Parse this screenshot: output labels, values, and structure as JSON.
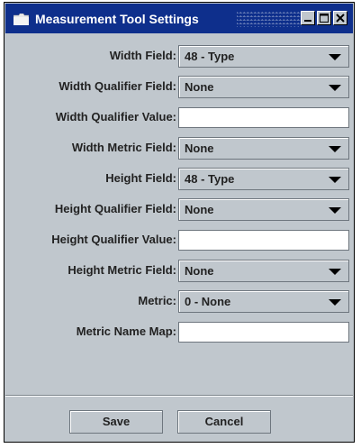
{
  "window": {
    "title": "Measurement Tool Settings",
    "controls": {
      "minimize_icon": "minimize-icon",
      "maximize_icon": "maximize-icon",
      "close_icon": "close-icon"
    }
  },
  "form": {
    "fields": [
      {
        "label": "Width Field:",
        "type": "select",
        "value": "48 - Type"
      },
      {
        "label": "Width Qualifier Field:",
        "type": "select",
        "value": "None"
      },
      {
        "label": "Width Qualifier Value:",
        "type": "text",
        "value": ""
      },
      {
        "label": "Width Metric Field:",
        "type": "select",
        "value": "None"
      },
      {
        "label": "Height Field:",
        "type": "select",
        "value": "48 - Type"
      },
      {
        "label": "Height Qualifier Field:",
        "type": "select",
        "value": "None"
      },
      {
        "label": "Height Qualifier Value:",
        "type": "text",
        "value": ""
      },
      {
        "label": "Height Metric Field:",
        "type": "select",
        "value": "None"
      },
      {
        "label": "Metric:",
        "type": "select",
        "value": "0 - None"
      },
      {
        "label": "Metric Name Map:",
        "type": "text",
        "value": ""
      }
    ]
  },
  "buttons": {
    "save": "Save",
    "cancel": "Cancel"
  },
  "colors": {
    "titlebar": "#0e2f8c",
    "window_bg": "#c0c7cd"
  }
}
